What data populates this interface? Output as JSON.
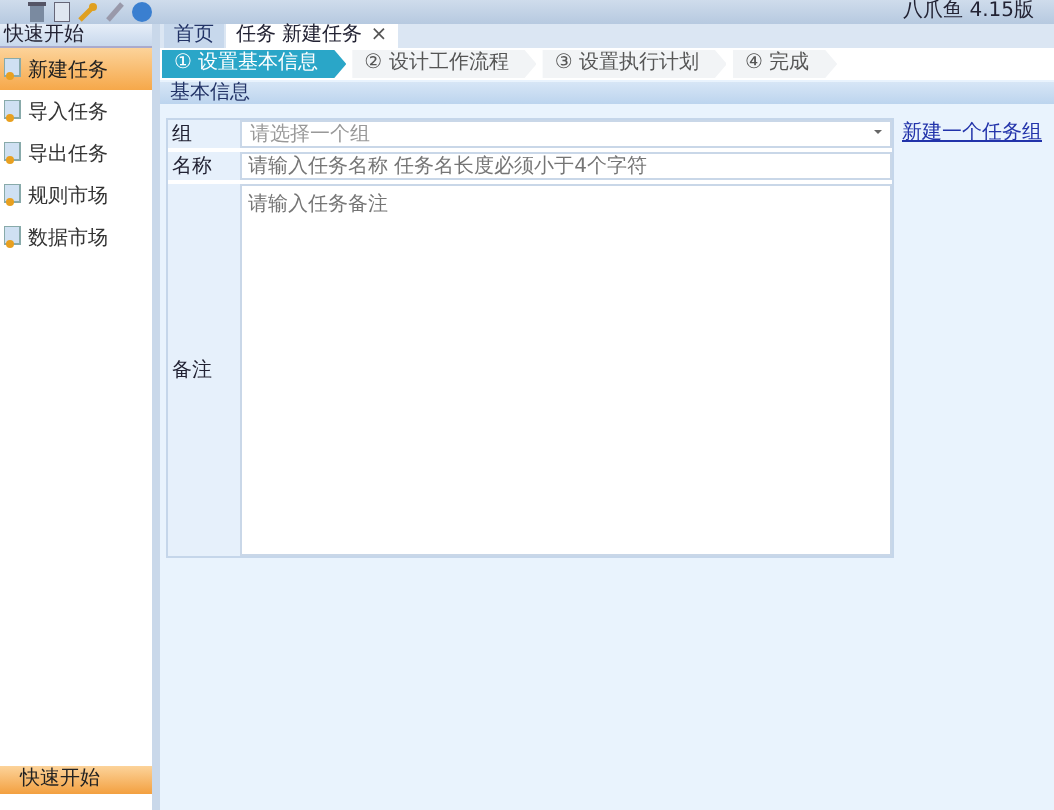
{
  "window": {
    "title": "八爪鱼 4.15版"
  },
  "sidebar": {
    "title": "快速开始",
    "items": [
      {
        "label": "新建任务",
        "selected": true
      },
      {
        "label": "导入任务",
        "selected": false
      },
      {
        "label": "导出任务",
        "selected": false
      },
      {
        "label": "规则市场",
        "selected": false
      },
      {
        "label": "数据市场",
        "selected": false
      }
    ],
    "footer": "快速开始"
  },
  "tabs": [
    {
      "label": "首页",
      "selected": false,
      "closable": false
    },
    {
      "label": "任务 新建任务",
      "selected": true,
      "closable": true
    }
  ],
  "close_glyph": "×",
  "steps": [
    {
      "num": "①",
      "label": "设置基本信息",
      "selected": true
    },
    {
      "num": "②",
      "label": "设计工作流程",
      "selected": false
    },
    {
      "num": "③",
      "label": "设置执行计划",
      "selected": false
    },
    {
      "num": "④",
      "label": "完成",
      "selected": false
    }
  ],
  "section": "基本信息",
  "form": {
    "fields": [
      {
        "kind": "select",
        "label": "组",
        "placeholder": "请选择一个组"
      },
      {
        "kind": "text",
        "label": "名称",
        "placeholder": "请输入任务名称 任务名长度必须小于4个字符"
      },
      {
        "kind": "textarea",
        "label": "备注",
        "placeholder": "请输入任务备注"
      }
    ],
    "link": "新建一个任务组"
  }
}
